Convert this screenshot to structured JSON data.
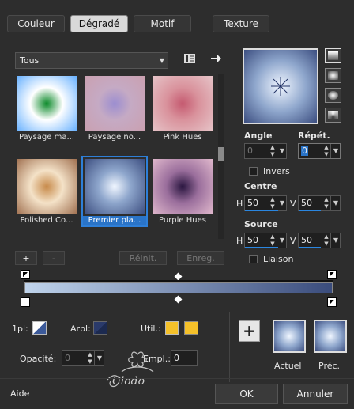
{
  "tabs": [
    "Couleur",
    "Dégradé",
    "Motif",
    "Texture"
  ],
  "category_select": "Tous",
  "gradients": [
    {
      "label": "Paysage ma...",
      "center": "#0c8a2a",
      "mid": "#ffffff",
      "outer": "#66b0ff"
    },
    {
      "label": "Paysage no...",
      "center": "#9c8ed0",
      "mid": "#c5aac4",
      "outer": "#caa0b0"
    },
    {
      "label": "Pink Hues",
      "center": "#c55a70",
      "mid": "#d9929c",
      "outer": "#e6c4c8"
    },
    {
      "label": "Polished Co...",
      "center": "#c78a4a",
      "mid": "#f4e2c8",
      "outer": "#a07050"
    },
    {
      "label": "Premier pla...",
      "center": "#f0f6ff",
      "mid": "#8ea6cc",
      "outer": "#3c4e80"
    },
    {
      "label": "Purple Hues",
      "center": "#2a1640",
      "mid": "#9a6e9c",
      "outer": "#e0b8cc"
    }
  ],
  "buttons": {
    "add": "+",
    "remove": "-",
    "reset": "Réinit.",
    "save": "Enreg."
  },
  "angle": {
    "label": "Angle",
    "value": "0"
  },
  "repeat": {
    "label": "Répét.",
    "value": "0"
  },
  "invert_label": "Invers",
  "center": {
    "label": "Centre",
    "h_label": "H",
    "h_value": "50",
    "v_label": "V",
    "v_value": "50"
  },
  "source": {
    "label": "Source",
    "h_label": "H",
    "h_value": "50",
    "v_label": "V",
    "v_value": "50"
  },
  "link_label": "Liaison",
  "gradient_bar": {
    "stop_left": "#c0d4ec",
    "stop_right": "#3a4c7c"
  },
  "bottom": {
    "first_plan_label": "1pl:",
    "background_label": "Arpl:",
    "util_label": "Util.:",
    "util_color": "#f5c12a",
    "opacity_label": "Opacité:",
    "opacity_value": "0",
    "empl_label": "Empl.:",
    "empl_value": "0",
    "current_label": "Actuel",
    "previous_label": "Préc."
  },
  "footer": {
    "help": "Aide",
    "ok": "OK",
    "cancel": "Annuler"
  },
  "watermark": "Clodo"
}
